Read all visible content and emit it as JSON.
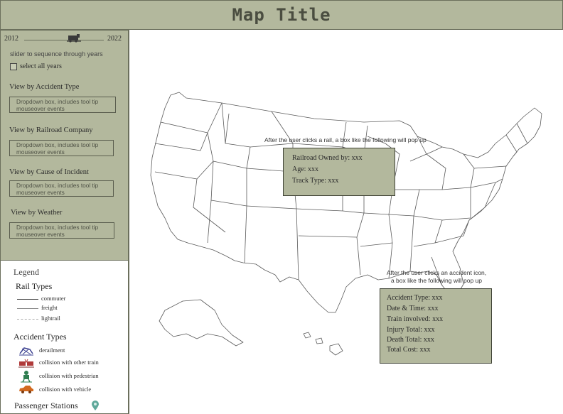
{
  "header": {
    "title": "Map Title"
  },
  "sidebar": {
    "year_start": "2012",
    "year_end": "2022",
    "slider_hint": "slider to sequence through years",
    "select_all_label": "select all years",
    "filters": [
      {
        "label": "View by Accident Type",
        "dropdown_text": "Dropdown box, includes tool tip mouseover events"
      },
      {
        "label": "View by Railroad Company",
        "dropdown_text": "Dropdown box, includes tool tip mouseover events"
      },
      {
        "label": "View by Cause of Incident",
        "dropdown_text": "Dropdown box, includes tool tip mouseover events"
      },
      {
        "label": "View by Weather",
        "dropdown_text": "Dropdown box, includes tool tip mouseover events"
      }
    ]
  },
  "legend": {
    "title": "Legend",
    "rail_types_title": "Rail Types",
    "rail_types": [
      "commuter",
      "freight",
      "lightrail"
    ],
    "accident_types_title": "Accident Types",
    "accident_types": [
      "derailment",
      "collision with other train",
      "collision with pedestrian",
      "collision with vehicle"
    ],
    "stations_label": "Passenger Stations",
    "icons": {
      "derailment": "train-derailment-icon",
      "collision_train": "train-collision-icon",
      "collision_pedestrian": "pedestrian-icon",
      "collision_vehicle": "car-icon",
      "station": "map-pin-icon"
    }
  },
  "rail_popup": {
    "caption": "After the user clicks a rail, a box like the following will pop up",
    "lines": [
      "Railroad Owned by: xxx",
      "Age: xxx",
      "Track Type: xxx"
    ]
  },
  "accident_popup": {
    "caption_line1": "After the user clicks an accident icon,",
    "caption_line2": "a box like the following will pop up",
    "lines": [
      "Accident Type: xxx",
      "Date & Time: xxx",
      "Train involved: xxx",
      "Injury Total: xxx",
      "Death Total: xxx",
      "Total Cost: xxx"
    ]
  },
  "colors": {
    "panel": "#b3b89d",
    "border": "#6b6f5c",
    "map_stroke": "#5a5a5a",
    "derailment_icon": "#3a3f8f",
    "collision_train_icon": "#b03a3a",
    "pedestrian_icon": "#2e7d4f",
    "car_icon": "#d2691e",
    "station_icon": "#5fa89a"
  }
}
